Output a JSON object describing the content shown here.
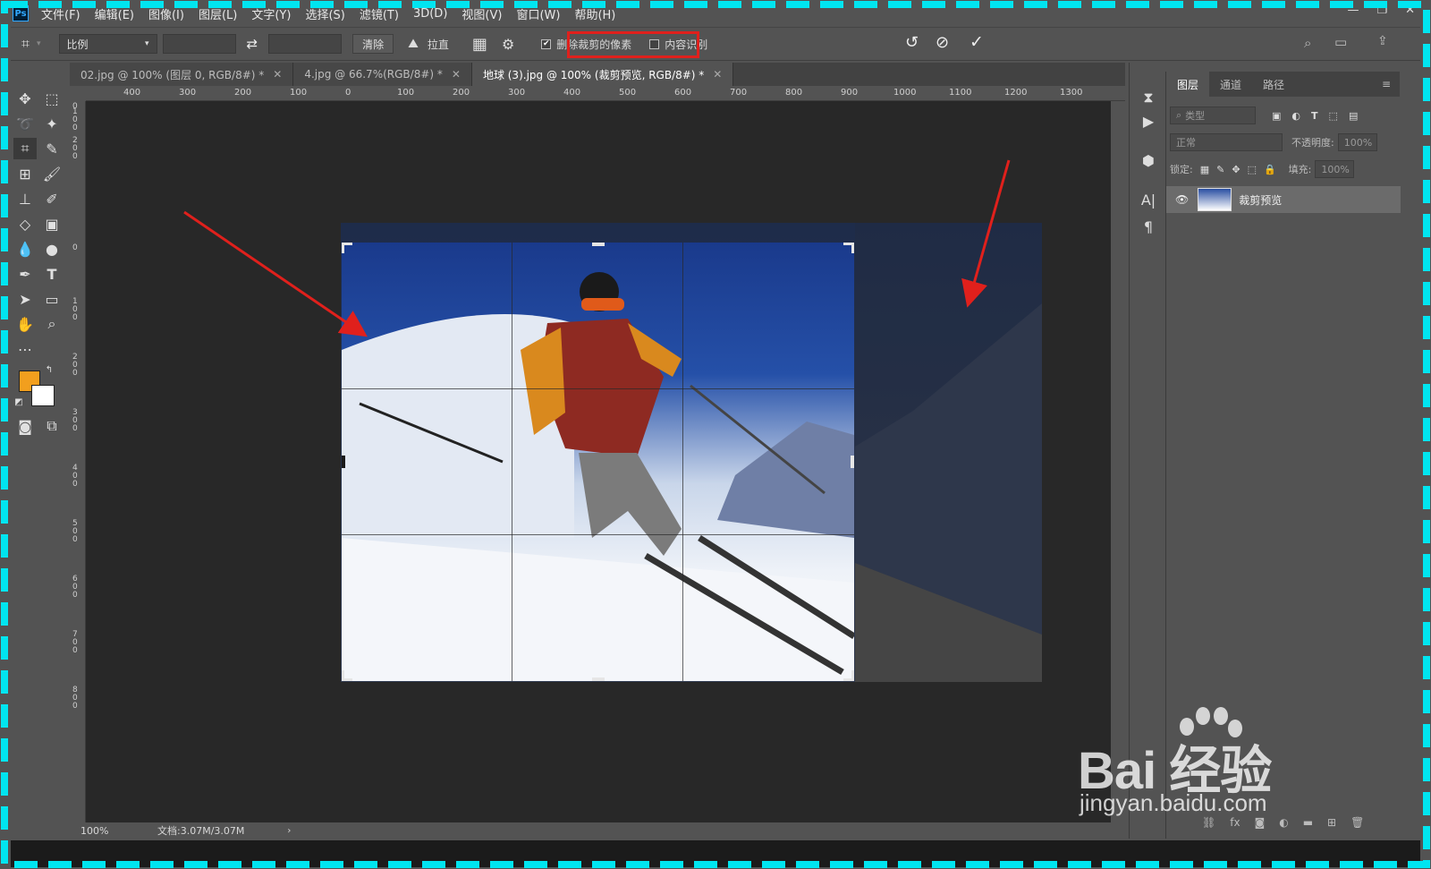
{
  "app": {
    "logo": "Ps"
  },
  "menu": [
    "文件(F)",
    "编辑(E)",
    "图像(I)",
    "图层(L)",
    "文字(Y)",
    "选择(S)",
    "滤镜(T)",
    "3D(D)",
    "视图(V)",
    "窗口(W)",
    "帮助(H)"
  ],
  "options": {
    "ratio_select": "比例",
    "swap_icon": "⇄",
    "clear_label": "清除",
    "straighten_label": "拉直",
    "delete_cropped_label": "删除裁剪的像素",
    "delete_cropped_checked": true,
    "content_aware_label": "内容识别",
    "content_aware_checked": false
  },
  "tabs": [
    {
      "label": "02.jpg @ 100% (图层 0, RGB/8#) *",
      "active": false
    },
    {
      "label": "4.jpg @ 66.7%(RGB/8#) *",
      "active": false
    },
    {
      "label": "地球 (3).jpg @ 100% (裁剪预览, RGB/8#) *",
      "active": true
    }
  ],
  "ruler": {
    "h_labels": [
      "400",
      "300",
      "200",
      "100",
      "0",
      "100",
      "200",
      "300",
      "400",
      "500",
      "600",
      "700",
      "800",
      "900",
      "1000",
      "1100",
      "1200",
      "1300"
    ],
    "v_labels": [
      "0",
      "100",
      "200",
      "0",
      "100",
      "200",
      "300",
      "400",
      "500",
      "600",
      "700",
      "800"
    ]
  },
  "status": {
    "zoom": "100%",
    "doc": "文档:3.07M/3.07M"
  },
  "layers_panel": {
    "tabs": [
      "图层",
      "通道",
      "路径"
    ],
    "filter_label": "类型",
    "blend_mode": "正常",
    "opacity_label": "不透明度:",
    "opacity_value": "100%",
    "lock_label": "锁定:",
    "fill_label": "填充:",
    "fill_value": "100%",
    "layer_name": "裁剪预览"
  },
  "watermark": {
    "brand": "Bai 经验",
    "url": "jingyan.baidu.com"
  },
  "colors": {
    "foreground": "#f29f1e",
    "background": "#ffffff",
    "highlight": "#e0201c",
    "frame": "#00e5f0"
  }
}
